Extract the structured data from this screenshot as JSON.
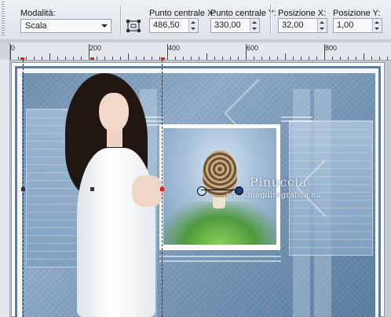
{
  "toolbar": {
    "mode": {
      "label": "Modalità:",
      "value": "Scala"
    },
    "pivot_x": {
      "label": "Punto centrale X:",
      "value": "486,50"
    },
    "pivot_y": {
      "label": "Punto centrale Y:",
      "value": "330,00"
    },
    "pos_x": {
      "label": "Posizione X:",
      "value": "32,00"
    },
    "pos_y": {
      "label": "Posizione Y:",
      "value": "1,00"
    }
  },
  "ruler": {
    "labels": [
      "0",
      "200",
      "400",
      "600",
      "800"
    ]
  },
  "canvas": {
    "watermark": "Pinuccia",
    "watermark_url": "www.magdiregrafica.eu"
  },
  "icons": {
    "mode_dropdown": "chevron-down-icon",
    "pick_tool": "pick-tool-icon",
    "pivot": "pivot-point-icon",
    "rotation": "rotation-handle-icon"
  },
  "colors": {
    "guide": "#333333",
    "marker": "#e02020",
    "rotation_handle": "#1c3f7a"
  }
}
